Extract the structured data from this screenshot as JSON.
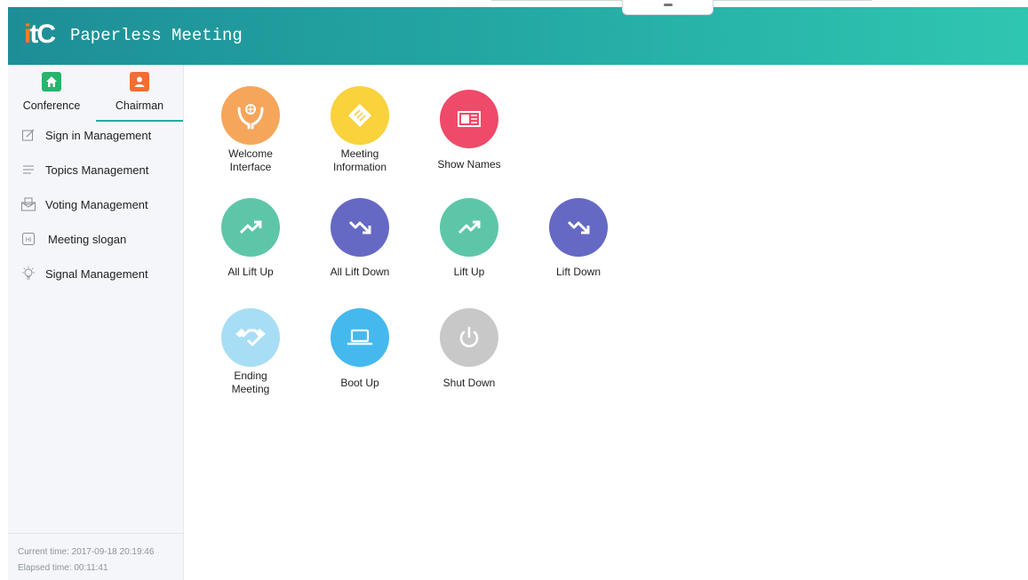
{
  "header": {
    "logo_text": "itC",
    "title": "Paperless Meeting"
  },
  "sidebar": {
    "tabs": [
      {
        "label": "Conference",
        "icon": "home-icon",
        "color": "#27b46b"
      },
      {
        "label": "Chairman",
        "icon": "user-icon",
        "color": "#f26d33",
        "active": true
      }
    ],
    "items": [
      {
        "label": "Sign in Management",
        "icon": "edit-icon"
      },
      {
        "label": "Topics Management",
        "icon": "list-icon"
      },
      {
        "label": "Voting Management",
        "icon": "ballot-icon"
      },
      {
        "label": "Meeting slogan",
        "icon": "slogan-icon"
      },
      {
        "label": "Signal Management",
        "icon": "bulb-icon"
      }
    ],
    "status": {
      "current_time": "Current time: 2017-09-18 20:19:46",
      "elapsed_time": "Elapsed time: 00:11:41"
    }
  },
  "functions": [
    {
      "label": "Welcome Interface",
      "icon": "hands-globe-icon",
      "color": "#f5a65b"
    },
    {
      "label": "Meeting Information",
      "icon": "document-icon",
      "color": "#f9d23c"
    },
    {
      "label": "Show Names",
      "icon": "name-card-icon",
      "color": "#ef4a69"
    },
    {
      "label": "All Lift Up",
      "icon": "trend-up-icon",
      "color": "#5dc6a9"
    },
    {
      "label": "All Lift Down",
      "icon": "trend-down-icon",
      "color": "#6569c4"
    },
    {
      "label": "Lift Up",
      "icon": "trend-up-icon",
      "color": "#5dc6a9"
    },
    {
      "label": "Lift Down",
      "icon": "trend-down-icon",
      "color": "#6569c4"
    },
    {
      "label": "Ending Meeting",
      "icon": "handshake-icon",
      "color": "#a8def5"
    },
    {
      "label": "Boot Up",
      "icon": "laptop-icon",
      "color": "#45b9ee"
    },
    {
      "label": "Shut Down",
      "icon": "power-icon",
      "color": "#c8c8c8"
    }
  ]
}
